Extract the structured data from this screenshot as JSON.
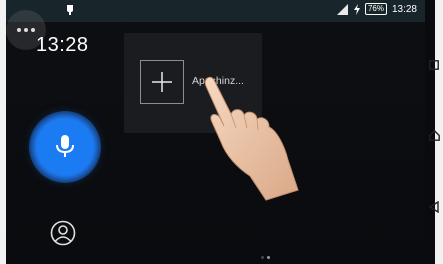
{
  "statusbar": {
    "time": "13:28",
    "battery_level": "76",
    "battery_unit": "%",
    "icons": [
      "notification-icon",
      "signal-icon",
      "charging-icon",
      "battery-icon"
    ]
  },
  "clock": {
    "time": "13:28"
  },
  "popup": {
    "add_icon": "plus-icon",
    "label": "Appshinz..."
  },
  "dock": {
    "mic_icon": "microphone-icon",
    "profile_icon": "user-circle-icon"
  },
  "page_indicator": {
    "count": 2,
    "active_index": 1
  },
  "navbar": {
    "icons": [
      "recents-icon",
      "home-icon",
      "back-icon"
    ]
  },
  "colors": {
    "accent": "#1a7bf2",
    "statusbar": "#18262b",
    "background": "#0a0b0e"
  }
}
